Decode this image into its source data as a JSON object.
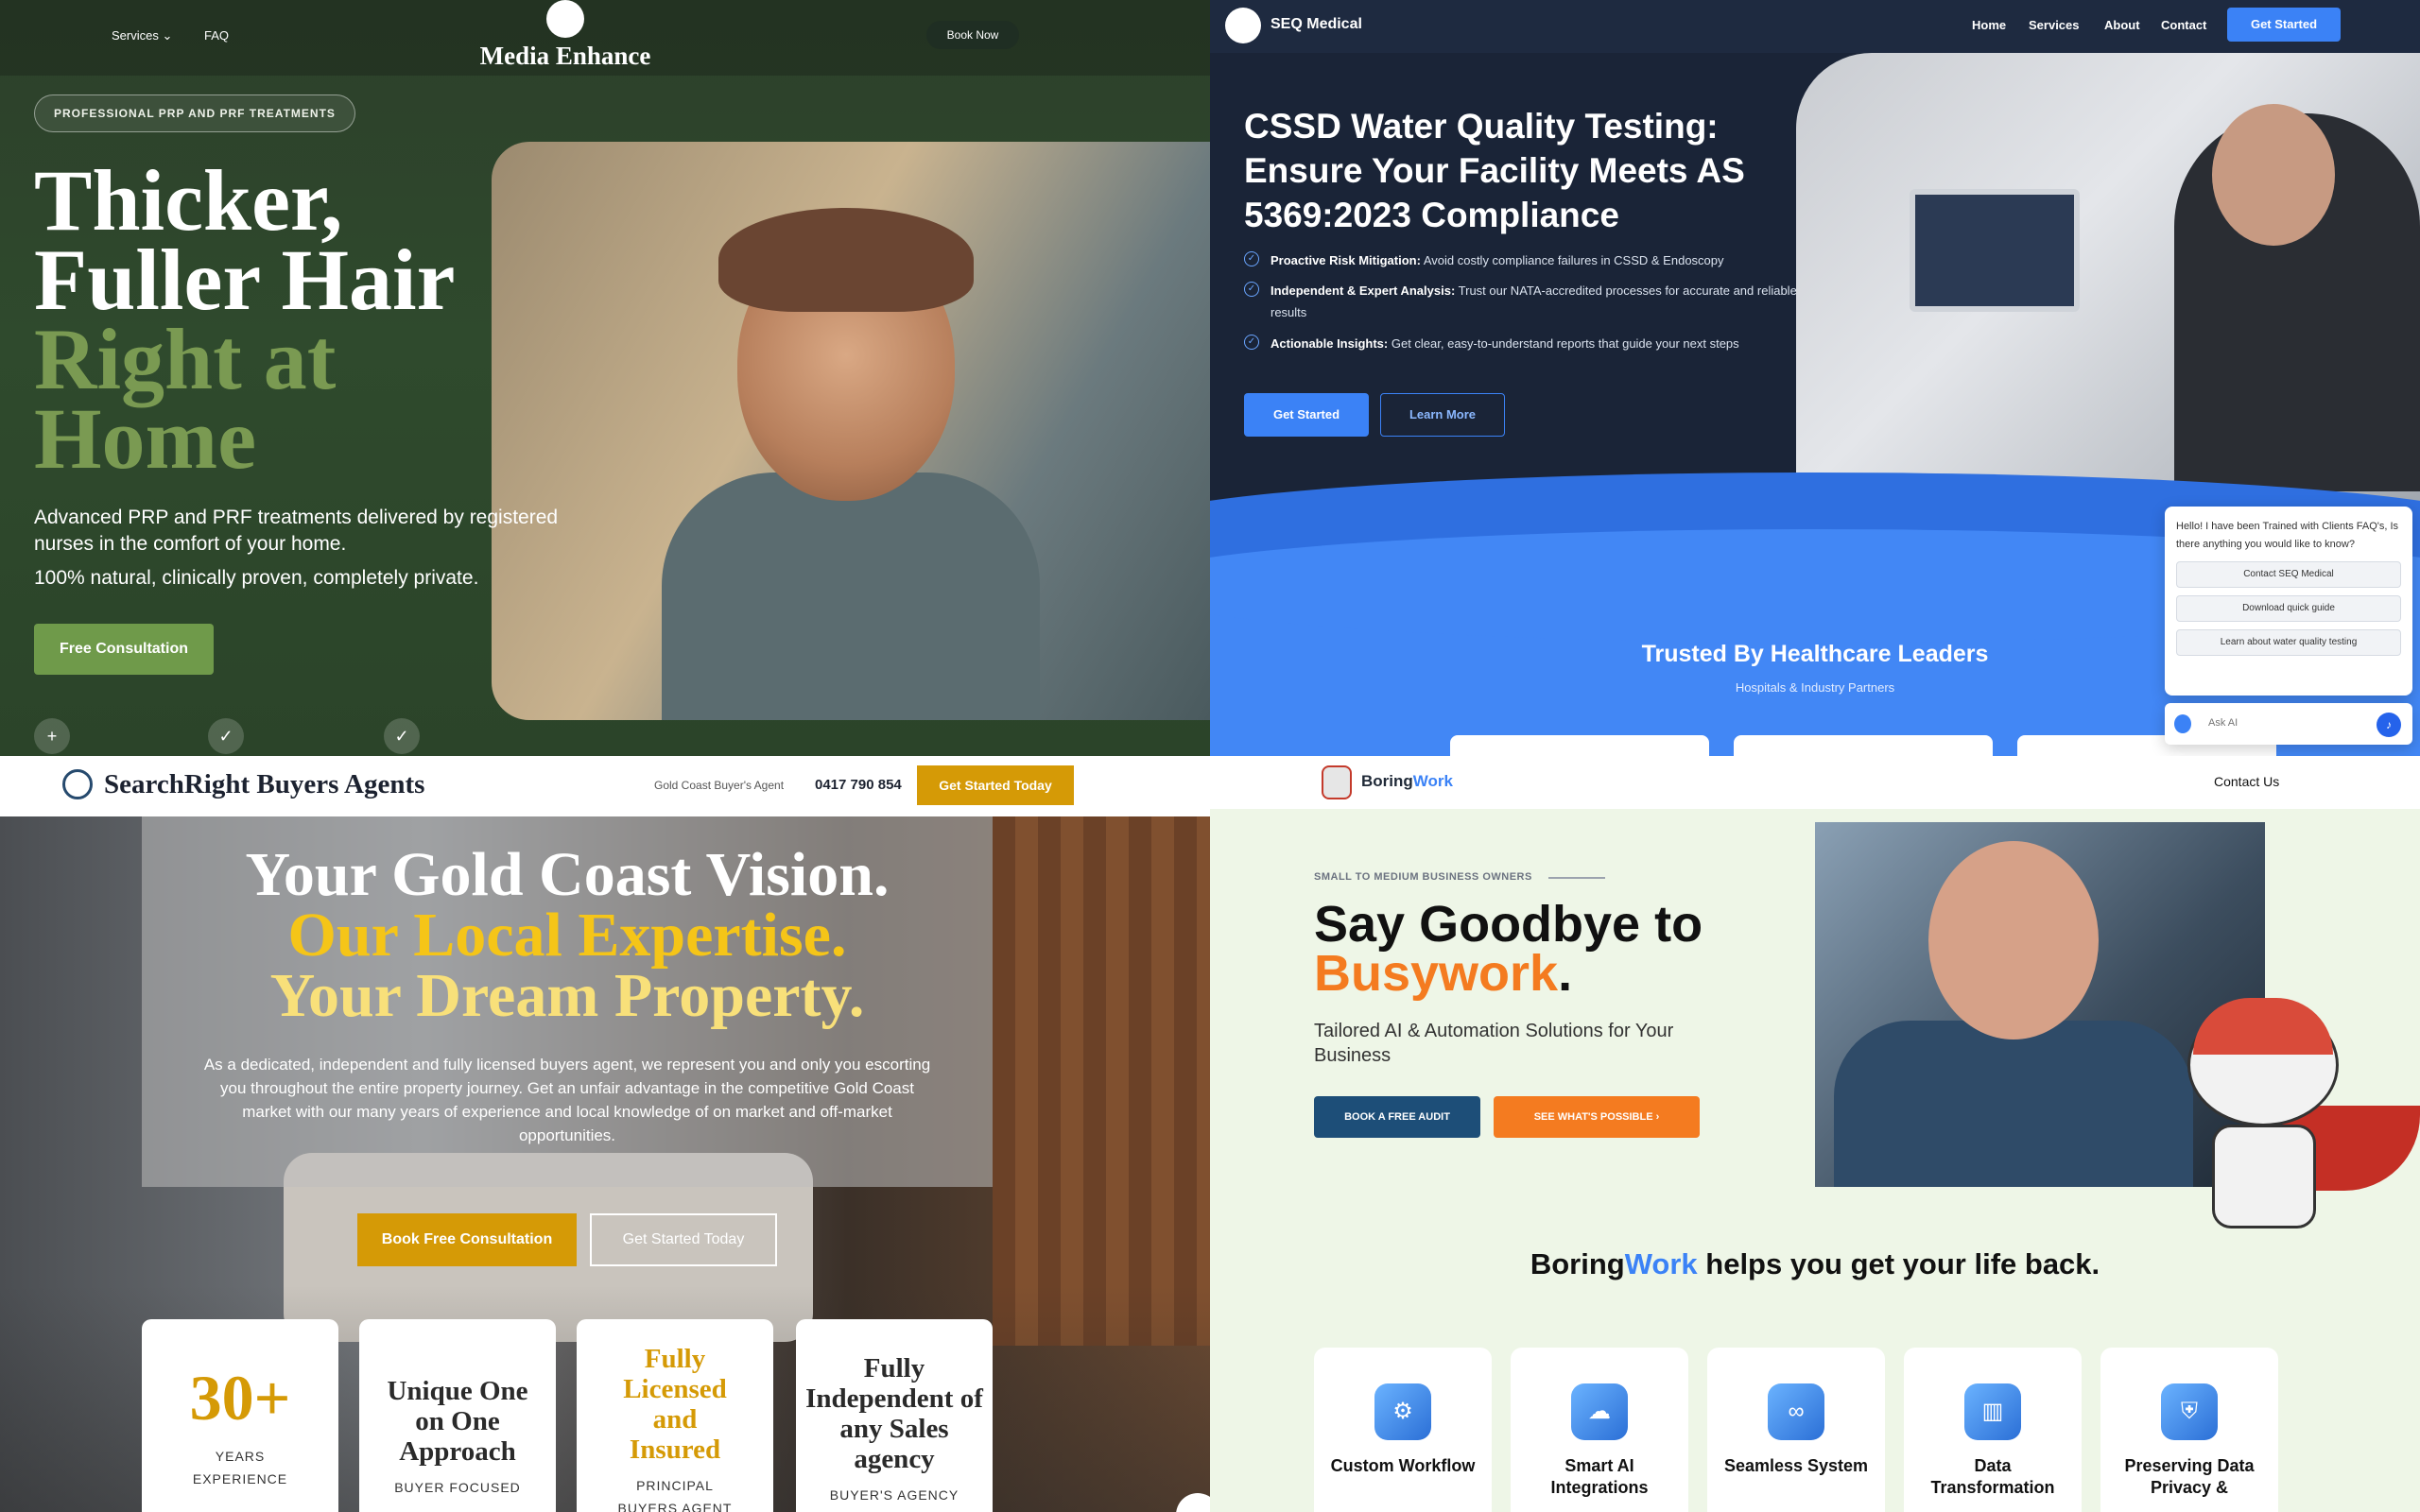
{
  "panels": {
    "media_enhance": {
      "nav": {
        "services": "Services",
        "faq": "FAQ",
        "logo": "Media Enhance",
        "book_now": "Book Now"
      },
      "pill": "PROFESSIONAL PRP AND PRF TREATMENTS",
      "headline": {
        "line1": "Thicker,",
        "line2": "Fuller Hair",
        "line3": "Right at",
        "line4": "Home"
      },
      "subtitle": "Advanced PRP and PRF treatments delivered by registered nurses in the comfort of your home.",
      "tagline": "100% natural, clinically proven, completely private.",
      "cta": "Free Consultation",
      "colors": {
        "background": "#2f4a2d",
        "accent": "#6f9a4a",
        "headline_accent": "#7a9a52"
      }
    },
    "seq_medical": {
      "nav": {
        "logo": "SEQ Medical",
        "home": "Home",
        "services": "Services",
        "about": "About",
        "contact": "Contact",
        "get_started": "Get Started"
      },
      "headline": "CSSD Water Quality Testing: Ensure Your Facility Meets AS 5369:2023 Compliance",
      "bullets": [
        {
          "title": "Proactive Risk Mitigation:",
          "text": " Avoid costly compliance failures in CSSD & Endoscopy"
        },
        {
          "title": "Independent & Expert Analysis:",
          "text": " Trust our NATA-accredited processes for accurate and reliable results"
        },
        {
          "title": "Actionable Insights:",
          "text": " Get clear, easy-to-understand reports that guide your next steps"
        }
      ],
      "btn_primary": "Get Started",
      "btn_secondary": "Learn More",
      "trusted_title": "Trusted By Healthcare Leaders",
      "trusted_sub": "Hospitals & Industry Partners",
      "chat": {
        "message": "Hello! I have been Trained with Clients FAQ's, Is there anything you would like to know?",
        "options": [
          "Contact SEQ Medical",
          "Download quick guide",
          "Learn about water quality testing"
        ],
        "placeholder": "Ask AI"
      },
      "colors": {
        "background": "#1a2437",
        "accent": "#3b82f6"
      }
    },
    "searchright": {
      "nav": {
        "logo": "SearchRight Buyers Agents",
        "label": "Gold Coast Buyer's Agent",
        "phone": "0417 790 854",
        "cta": "Get Started Today"
      },
      "headline": {
        "line1": "Your Gold Coast Vision.",
        "line2": "Our Local Expertise.",
        "line3": "Your Dream Property."
      },
      "paragraph": "As a dedicated, independent and fully licensed buyers agent, we represent you and only you escorting you throughout the entire property journey. Get an unfair advantage in the competitive Gold Coast market with our many years of experience and local knowledge of on market and off-market opportunities.",
      "btn_primary": "Book Free Consultation",
      "btn_secondary": "Get Started Today",
      "stats": [
        {
          "big": "30+",
          "sub": "YEARS EXPERIENCE"
        },
        {
          "title": "Unique One on One Approach",
          "sub": "BUYER FOCUSED"
        },
        {
          "title": "Fully Licensed and Insured",
          "sub": "PRINCIPAL BUYERS AGENT"
        },
        {
          "title": "Fully Independent of any Sales agency",
          "sub": "BUYER'S AGENCY"
        }
      ],
      "colors": {
        "gold": "#d59a06",
        "light_gold": "#f5d76e"
      }
    },
    "boringwork": {
      "nav": {
        "logo_a": "Boring",
        "logo_b": "Work",
        "contact": "Contact Us"
      },
      "eyebrow": "SMALL TO MEDIUM BUSINESS OWNERS",
      "headline_a": "Say Goodbye to",
      "headline_b": "Busywork",
      "headline_dot": ".",
      "subtitle": "Tailored AI & Automation Solutions for Your Business",
      "btn_primary": "BOOK A FREE AUDIT",
      "btn_secondary": "SEE WHAT'S POSSIBLE",
      "tagline": {
        "brand_a": "Boring",
        "brand_b": "Work",
        "rest": " helps you get your life back."
      },
      "features": [
        {
          "title": "Custom Workflow",
          "icon": "workflow-icon"
        },
        {
          "title": "Smart AI Integrations",
          "icon": "brain-icon"
        },
        {
          "title": "Seamless System",
          "icon": "link-icon"
        },
        {
          "title": "Data Transformation",
          "icon": "chart-icon"
        },
        {
          "title": "Preserving Data Privacy &",
          "icon": "shield-icon"
        }
      ],
      "colors": {
        "background": "#eef6e7",
        "orange": "#f47b20",
        "blue": "#3b82f6",
        "navy": "#1d4e78"
      }
    }
  }
}
